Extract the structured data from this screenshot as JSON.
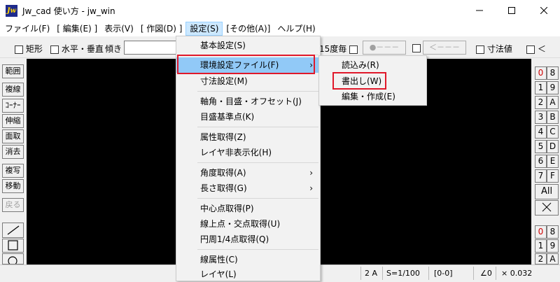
{
  "window": {
    "title": "Jw_cad 使い方 - jw_win",
    "app_icon_text": "Jw"
  },
  "menubar": {
    "items": [
      "ファイル(F)",
      "[ 編集(E) ]",
      "表示(V)",
      "[ 作図(D) ]",
      "設定(S)",
      "[その他(A)]",
      "ヘルプ(H)"
    ]
  },
  "toolbar": {
    "rect_label": "矩形",
    "hv_label": "水平・垂直",
    "angle_label": "傾き",
    "per15_label": "15度毎",
    "btn1_label": "●－－－",
    "btn2_label": "＜－－－",
    "dimension_label": "寸法値",
    "less_label": "＜"
  },
  "left_tools": [
    "範囲",
    "複線",
    "ｺｰﾅｰ",
    "伸縮",
    "面取",
    "消去",
    "複写",
    "移動",
    "戻る"
  ],
  "right_layers": {
    "left_col": [
      "0",
      "1",
      "2",
      "3",
      "4",
      "5",
      "6",
      "7"
    ],
    "right_col": [
      "8",
      "9",
      "A",
      "B",
      "C",
      "D",
      "E",
      "F"
    ],
    "all_label": "All",
    "group_left": [
      "0",
      "1",
      "2"
    ],
    "group_right": [
      "8",
      "9",
      "A"
    ]
  },
  "settings_menu": {
    "items": [
      {
        "label": "基本設定(S)"
      },
      {
        "label": "環境設定ファイル(F)"
      },
      {
        "label": "寸法設定(M)"
      },
      {
        "label": "軸角・目盛・オフセット(J)"
      },
      {
        "label": "目盛基準点(K)"
      },
      {
        "label": "属性取得(Z)"
      },
      {
        "label": "レイヤ非表示化(H)"
      },
      {
        "label": "角度取得(A)"
      },
      {
        "label": "長さ取得(G)"
      },
      {
        "label": "中心点取得(P)"
      },
      {
        "label": "線上点・交点取得(U)"
      },
      {
        "label": "円周1/4点取得(Q)"
      },
      {
        "label": "線属性(C)"
      },
      {
        "label": "レイヤ(L)"
      }
    ]
  },
  "env_submenu": {
    "items": [
      "読込み(R)",
      "書出し(W)",
      "編集・作成(E)"
    ]
  },
  "statusbar": {
    "layer": "2 A",
    "scale": "S=1/100",
    "group": "[0-0]",
    "angle": "∠0",
    "ratio": "× 0.032"
  }
}
